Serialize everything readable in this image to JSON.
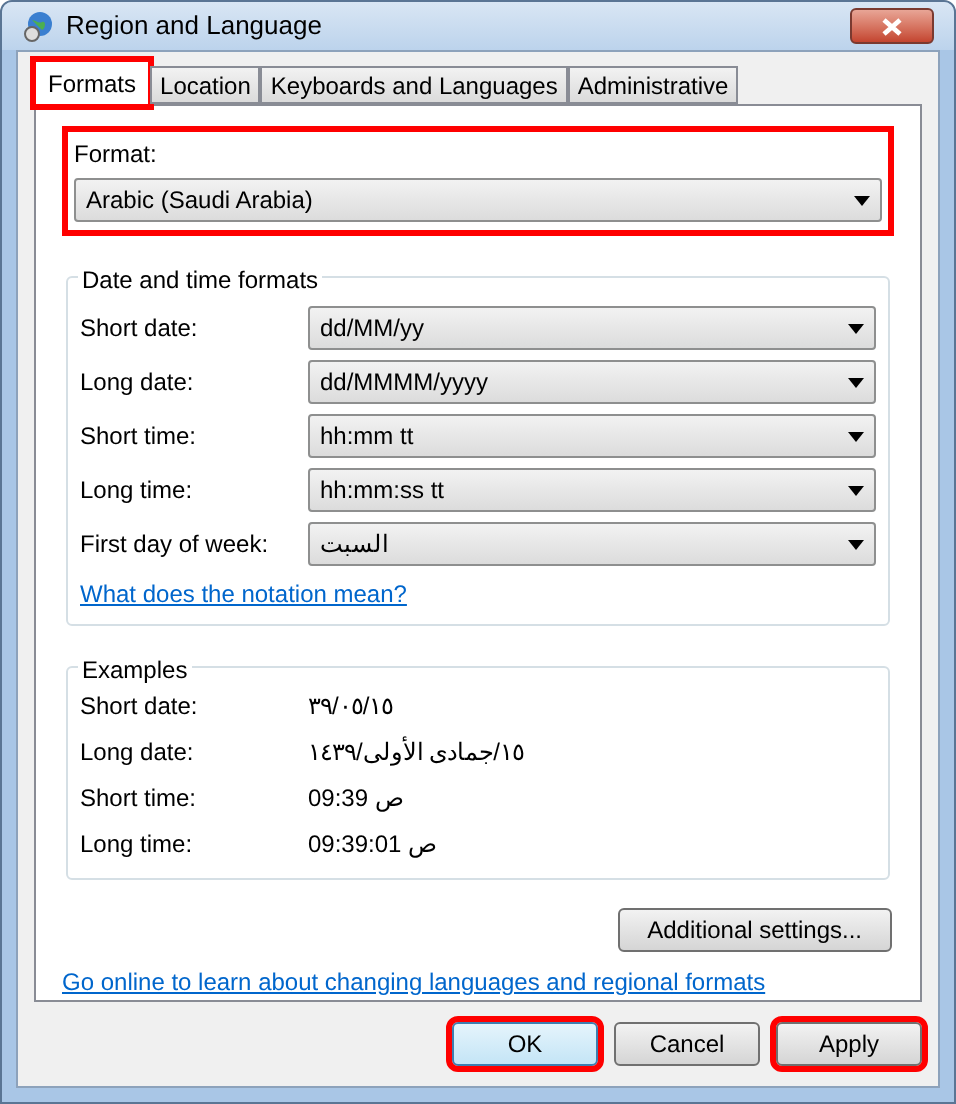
{
  "window": {
    "title": "Region and Language"
  },
  "tabs": [
    {
      "label": "Formats",
      "selected": true,
      "highlighted": true
    },
    {
      "label": "Location",
      "selected": false,
      "highlighted": false
    },
    {
      "label": "Keyboards and Languages",
      "selected": false,
      "highlighted": false
    },
    {
      "label": "Administrative",
      "selected": false,
      "highlighted": false
    }
  ],
  "format": {
    "label": "Format:",
    "value": "Arabic (Saudi Arabia)",
    "highlighted": true
  },
  "date_time_formats": {
    "title": "Date and time formats",
    "rows": [
      {
        "label": "Short date:",
        "value": "dd/MM/yy"
      },
      {
        "label": "Long date:",
        "value": "dd/MMMM/yyyy"
      },
      {
        "label": "Short time:",
        "value": "hh:mm tt"
      },
      {
        "label": "Long time:",
        "value": "hh:mm:ss tt"
      },
      {
        "label": "First day of week:",
        "value": "السبت"
      }
    ],
    "link": "What does the notation mean?"
  },
  "examples": {
    "title": "Examples",
    "rows": [
      {
        "label": "Short date:",
        "value": "٣٩/٠٥/١٥"
      },
      {
        "label": "Long date:",
        "value": "١٥/جمادى الأولى/١٤٣٩"
      },
      {
        "label": "Short time:",
        "value": "09:39 ص"
      },
      {
        "label": "Long time:",
        "value": "09:39:01 ص"
      }
    ]
  },
  "additional_button": "Additional settings...",
  "online_link": "Go online to learn about changing languages and regional formats",
  "buttons": [
    {
      "label": "OK",
      "highlighted": true,
      "default": true
    },
    {
      "label": "Cancel",
      "highlighted": false,
      "default": false
    },
    {
      "label": "Apply",
      "highlighted": true,
      "default": false
    }
  ]
}
